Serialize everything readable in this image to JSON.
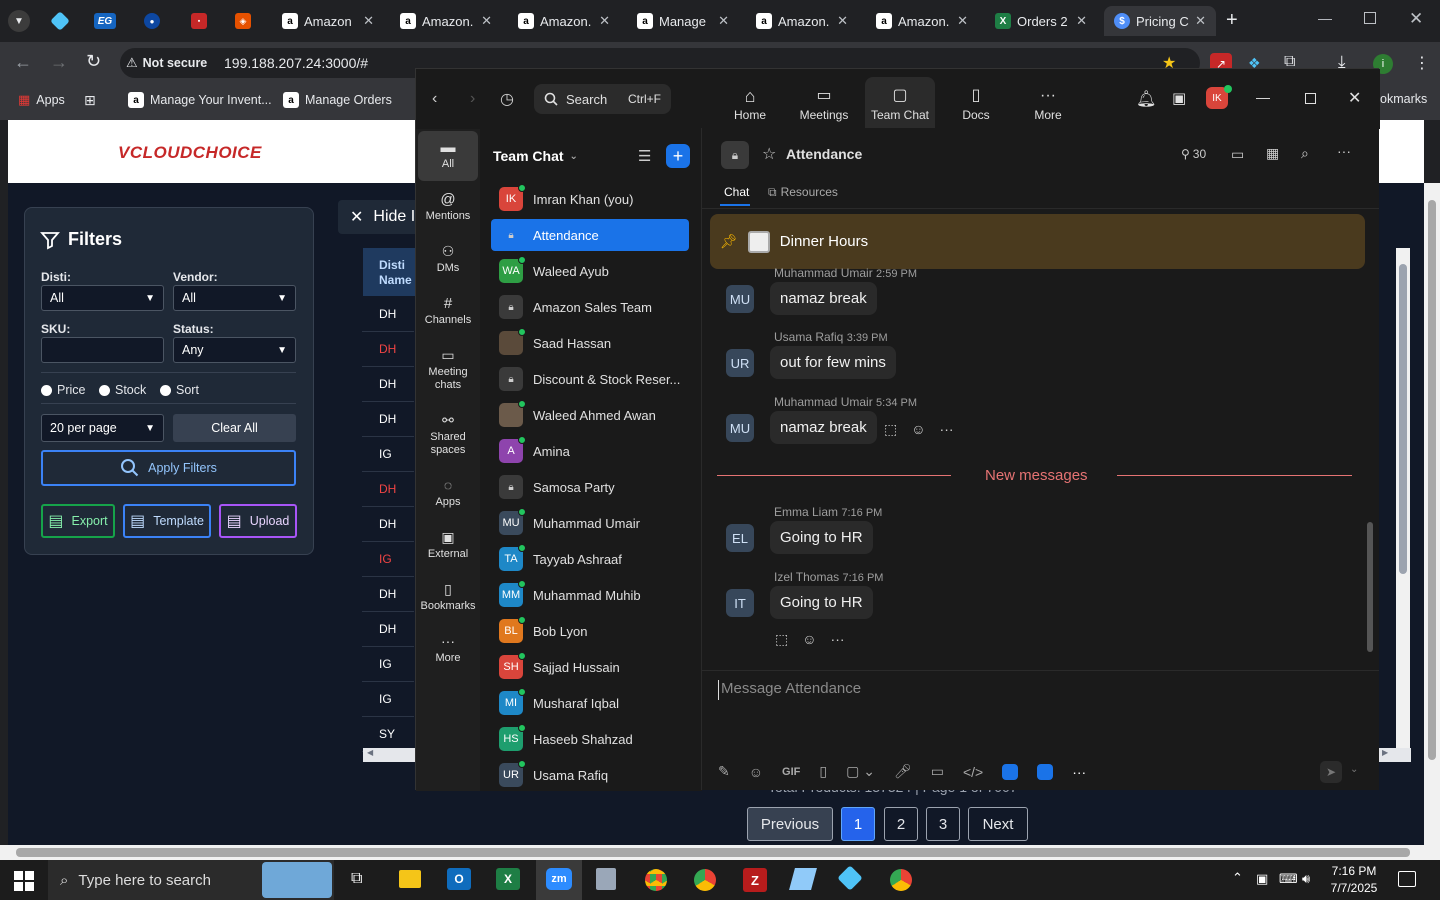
{
  "browser": {
    "tabs": [
      {
        "label": "Amazon",
        "favicon": "a"
      },
      {
        "label": "Amazon.",
        "favicon": "a"
      },
      {
        "label": "Amazon.",
        "favicon": "a"
      },
      {
        "label": "Manage",
        "favicon": "a"
      },
      {
        "label": "Amazon.",
        "favicon": "a"
      },
      {
        "label": "Amazon.",
        "favicon": "a"
      },
      {
        "label": "Orders 2",
        "favicon": "X"
      },
      {
        "label": "Pricing C",
        "favicon": "$"
      }
    ],
    "pinned": [
      "EG"
    ],
    "security": "Not secure",
    "url": "199.188.207.24:3000/#",
    "bookmarks": [
      "Apps",
      "Manage Your Invent...",
      "Manage Orders"
    ],
    "bookmarks_right": "okmarks"
  },
  "app": {
    "logo": "VCLOUDCHOICE",
    "hide_button": "Hide I",
    "filters": {
      "title": "Filters",
      "disti_label": "Disti:",
      "disti_value": "All",
      "vendor_label": "Vendor:",
      "vendor_value": "All",
      "sku_label": "SKU:",
      "status_label": "Status:",
      "status_value": "Any",
      "radios": [
        "Price",
        "Stock",
        "Sort"
      ],
      "per_page": "20 per page",
      "clear": "Clear All",
      "apply": "Apply Filters",
      "export": "Export",
      "template": "Template",
      "upload": "Upload"
    },
    "table": {
      "header": [
        "Disti",
        "Name"
      ],
      "rows": [
        {
          "disti": "DH",
          "red": false
        },
        {
          "disti": "DH",
          "red": true
        },
        {
          "disti": "DH",
          "red": false
        },
        {
          "disti": "DH",
          "red": false
        },
        {
          "disti": "IG",
          "red": false
        },
        {
          "disti": "DH",
          "red": true
        },
        {
          "disti": "DH",
          "red": false
        },
        {
          "disti": "IG",
          "red": true
        },
        {
          "disti": "DH",
          "red": false
        },
        {
          "disti": "DH",
          "red": false
        },
        {
          "disti": "IG",
          "red": false
        },
        {
          "disti": "IG",
          "red": false
        },
        {
          "disti": "SY",
          "red": false
        }
      ]
    },
    "total_text": "Total Products: 137324 | Page 1 of 7007",
    "pagination": {
      "previous": "Previous",
      "pages": [
        "1",
        "2",
        "3"
      ],
      "next": "Next",
      "current": "1"
    }
  },
  "zoom": {
    "search": "Search",
    "search_shortcut": "Ctrl+F",
    "nav": [
      {
        "label": "Home",
        "icon": "home-icon"
      },
      {
        "label": "Meetings",
        "icon": "video-icon"
      },
      {
        "label": "Team Chat",
        "icon": "chat-icon"
      },
      {
        "label": "Docs",
        "icon": "doc-icon"
      },
      {
        "label": "More",
        "icon": "more-icon"
      }
    ],
    "user_initials": "IK",
    "rail": [
      {
        "label": "All"
      },
      {
        "label": "Mentions"
      },
      {
        "label": "DMs"
      },
      {
        "label": "Channels"
      },
      {
        "label": "Meeting chats"
      },
      {
        "label": "Shared spaces"
      },
      {
        "label": "Apps"
      },
      {
        "label": "External"
      },
      {
        "label": "Bookmarks"
      },
      {
        "label": "More"
      }
    ],
    "list_title": "Team Chat",
    "contacts": [
      {
        "name": "Imran Khan (you)",
        "initials": "IK",
        "color": "#d9453b",
        "type": "avatar"
      },
      {
        "name": "Attendance",
        "initials": "",
        "color": "",
        "type": "lock",
        "selected": true
      },
      {
        "name": "Waleed Ayub",
        "initials": "WA",
        "color": "#2e9e44",
        "type": "avatar"
      },
      {
        "name": "Amazon Sales Team",
        "initials": "",
        "color": "",
        "type": "lock"
      },
      {
        "name": "Saad Hassan",
        "initials": "",
        "color": "#5a4a3a",
        "type": "photo"
      },
      {
        "name": "Discount & Stock Reser...",
        "initials": "",
        "color": "",
        "type": "lock"
      },
      {
        "name": "Waleed Ahmed Awan",
        "initials": "",
        "color": "#6b5a4a",
        "type": "photo"
      },
      {
        "name": "Amina",
        "initials": "A",
        "color": "#8e44ad",
        "type": "avatar"
      },
      {
        "name": "Samosa Party",
        "initials": "",
        "color": "",
        "type": "lock"
      },
      {
        "name": "Muhammad Umair",
        "initials": "MU",
        "color": "#3a4a5c",
        "type": "avatar"
      },
      {
        "name": "Tayyab Ashraaf",
        "initials": "TA",
        "color": "#1e88c7",
        "type": "avatar"
      },
      {
        "name": "Muhammad Muhib",
        "initials": "MM",
        "color": "#1e88c7",
        "type": "avatar"
      },
      {
        "name": "Bob Lyon",
        "initials": "BL",
        "color": "#e0781e",
        "type": "avatar"
      },
      {
        "name": "Sajjad Hussain",
        "initials": "SH",
        "color": "#d9453b",
        "type": "avatar"
      },
      {
        "name": "Musharaf Iqbal",
        "initials": "MI",
        "color": "#1e88c7",
        "type": "avatar"
      },
      {
        "name": "Haseeb Shahzad",
        "initials": "HS",
        "color": "#1e9e6e",
        "type": "avatar"
      },
      {
        "name": "Usama Rafiq",
        "initials": "UR",
        "color": "#3a4a5c",
        "type": "avatar"
      }
    ],
    "channel": {
      "name": "Attendance",
      "members": "30",
      "tabs": [
        "Chat",
        "Resources"
      ],
      "pinned": "Dinner Hours",
      "new_messages": "New messages",
      "composer_placeholder": "Message Attendance",
      "messages": [
        {
          "initials": "MU",
          "sender": "Muhammad Umair",
          "time": "2:59 PM",
          "text": "namaz break"
        },
        {
          "initials": "UR",
          "sender": "Usama Rafiq",
          "time": "3:39 PM",
          "text": "out for few mins"
        },
        {
          "initials": "MU",
          "sender": "Muhammad Umair",
          "time": "5:34 PM",
          "text": "namaz break"
        },
        {
          "initials": "EL",
          "sender": "Emma Liam",
          "time": "7:16 PM",
          "text": "Going to HR"
        },
        {
          "initials": "IT",
          "sender": "Izel Thomas",
          "time": "7:16 PM",
          "text": "Going to HR"
        }
      ],
      "gif": "GIF"
    }
  },
  "taskbar": {
    "search": "Type here to search",
    "time": "7:16 PM",
    "date": "7/7/2025",
    "zm": "zm"
  }
}
